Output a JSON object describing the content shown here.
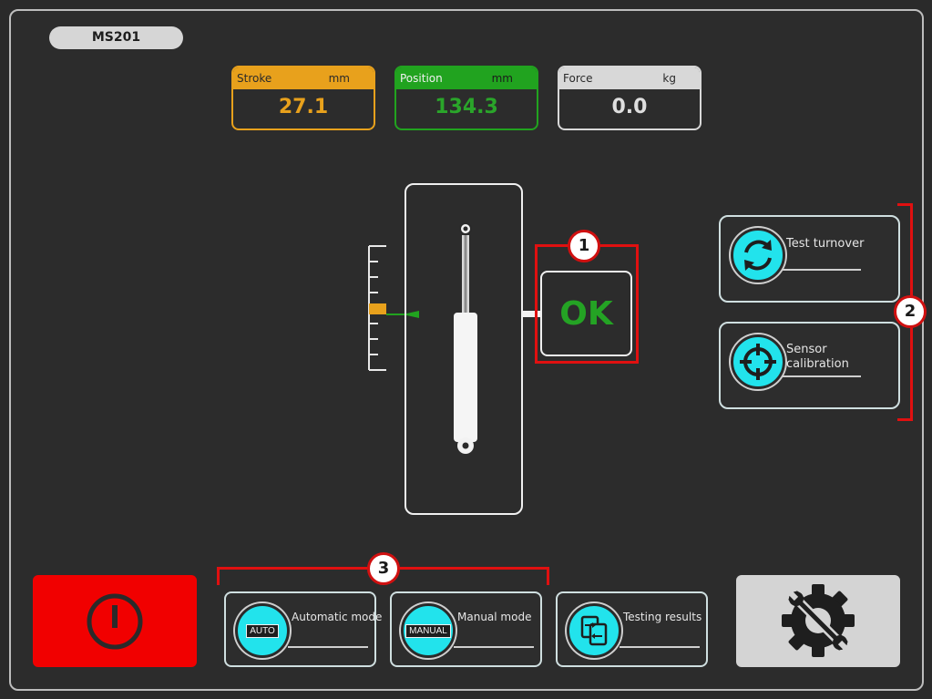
{
  "device": {
    "label": "MS201"
  },
  "meters": {
    "stroke": {
      "label": "Stroke",
      "unit": "mm",
      "value": "27.1",
      "color": "#e8a11c"
    },
    "position": {
      "label": "Position",
      "unit": "mm",
      "value": "134.3",
      "color": "#21a31f"
    },
    "force": {
      "label": "Force",
      "unit": "kg",
      "value": "0.0",
      "color": "#d8d8d8"
    }
  },
  "status": {
    "text": "OK",
    "color": "#24a324"
  },
  "side_buttons": {
    "turnover": {
      "label": "Test turnover",
      "icon": "rotate-icon"
    },
    "calibration": {
      "label_line1": "Sensor",
      "label_line2": "calibration",
      "icon": "crosshair-icon"
    }
  },
  "modes": {
    "auto": {
      "label": "Automatic mode",
      "tag": "AUTO"
    },
    "manual": {
      "label": "Manual mode",
      "tag": "MANUAL"
    },
    "results": {
      "label": "Testing results",
      "icon": "document-transfer-icon"
    }
  },
  "callouts": {
    "one": "1",
    "two": "2",
    "three": "3",
    "color": "#e01010"
  },
  "controls": {
    "power": {
      "icon": "power-icon",
      "color": "#f10000"
    },
    "settings": {
      "icon": "settings-icon"
    }
  }
}
